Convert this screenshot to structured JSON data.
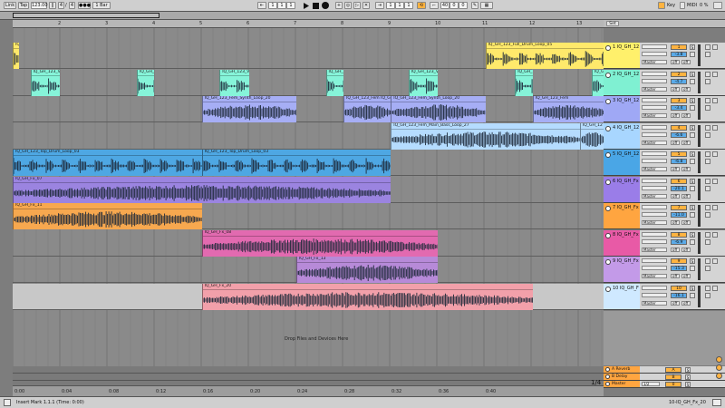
{
  "toolbar": {
    "link": "Link",
    "tap": "Tap",
    "tempo": "123.00",
    "sig_num": "4",
    "sig_den": "4",
    "metro": "●●●",
    "quant": "1 Bar",
    "pos_bar": "1",
    "pos_beat": "1",
    "pos_six": "1",
    "loop_bar": "1",
    "loop_beat": "1",
    "loop_six": "1",
    "loop_len_bar": "40",
    "loop_len_beat": "0",
    "loop_len_six": "0",
    "key": "Key",
    "midi": "MIDI",
    "cpu": "0 %"
  },
  "ruler": {
    "bars": [
      "2",
      "3",
      "4",
      "5",
      "6",
      "7",
      "8",
      "9",
      "10",
      "11",
      "12",
      "13"
    ],
    "set_label": "Set"
  },
  "timeline": {
    "marks": [
      "0:00",
      "0:04",
      "0:08",
      "0:12",
      "0:16",
      "0:20",
      "0:24",
      "0:28",
      "0:32",
      "0:36",
      "0:40"
    ]
  },
  "tracks": [
    {
      "id": 1,
      "name": "1 IQ_GH_12",
      "color": "#fff06b",
      "clip_color": "#ffe96b",
      "clips": [
        {
          "name": "IQ",
          "start": 0,
          "end": 1
        },
        {
          "name": "IQ_GH_123_Full_Drum_Loop_05",
          "start": 80,
          "end": 100
        }
      ],
      "num": "1",
      "vol": "-3.8"
    },
    {
      "id": 2,
      "name": "2 IQ_GH_12",
      "color": "#7ff0d2",
      "clip_color": "#86f4d9",
      "clips": [
        {
          "name": "IQ_GH_123_Voc",
          "start": 3,
          "end": 8
        },
        {
          "name": "IQ_GH_1",
          "start": 21,
          "end": 24
        },
        {
          "name": "IQ_GH_123_Voc",
          "start": 35,
          "end": 40
        },
        {
          "name": "IQ_GH_1",
          "start": 53,
          "end": 56
        },
        {
          "name": "IQ_GH_123_Voc",
          "start": 67,
          "end": 72
        },
        {
          "name": "IQ_GH_1",
          "start": 85,
          "end": 88
        },
        {
          "name": "IQ_GH_1",
          "start": 98,
          "end": 100
        }
      ],
      "num": "2",
      "vol": "-4.7"
    },
    {
      "id": 3,
      "name": "3 IQ_GH_12",
      "color": "#9fa8f5",
      "clip_color": "#a6aef5",
      "clips": [
        {
          "name": "IQ_GH_123_Fem_Synth_Loop_20",
          "start": 32,
          "end": 48
        },
        {
          "name": "IQ_GH_123_Fem IQ_GH_1",
          "start": 56,
          "end": 64
        },
        {
          "name": "IQ_GH_123_Fem_Synth_Loop_20",
          "start": 64,
          "end": 80
        },
        {
          "name": "IQ_GH_123_Fem",
          "start": 88,
          "end": 100
        }
      ],
      "num": "3",
      "vol": "-3.4"
    },
    {
      "id": 4,
      "name": "4 IQ_GH_12",
      "color": "#a8d6ff",
      "clip_color": "#b5dcff",
      "clips": [
        {
          "name": "IQ_GH_123_Fem_Main_Bass_Loop_27",
          "start": 64,
          "end": 96
        },
        {
          "name": "IQ_GH_12",
          "start": 96,
          "end": 100
        }
      ],
      "num": "4",
      "vol": "-6.6"
    },
    {
      "id": 5,
      "name": "5 IQ_GH_12",
      "color": "#4aa6e6",
      "clip_color": "#4ea7e3",
      "clips": [
        {
          "name": "IQ_GH_123_Top_Drum_Loop_03",
          "start": 0,
          "end": 32
        },
        {
          "name": "IQ_GH_123_Top_Drum_Loop_03",
          "start": 32,
          "end": 64
        }
      ],
      "num": "5",
      "vol": "-6.8"
    },
    {
      "id": 6,
      "name": "6 IQ_GH_Fx",
      "color": "#9a7de8",
      "clip_color": "#9b84e0",
      "clips": [
        {
          "name": "IQ_GH_Fx_07",
          "start": 0,
          "end": 64
        }
      ],
      "num": "6",
      "vol": "-20.1"
    },
    {
      "id": 7,
      "name": "7 IQ_GH_Fx",
      "color": "#ffa540",
      "clip_color": "#f7a84f",
      "clips": [
        {
          "name": "IQ_GH_Fx_11",
          "start": 0,
          "end": 32
        }
      ],
      "num": "7",
      "vol": "-11.0"
    },
    {
      "id": 8,
      "name": "8 IQ_GH_Fx",
      "color": "#e85aa6",
      "clip_color": "#e26ab0",
      "clips": [
        {
          "name": "IQ_GH_Fx_08",
          "start": 32,
          "end": 72
        }
      ],
      "num": "8",
      "vol": "-6.9"
    },
    {
      "id": 9,
      "name": "9 IQ_GH_Fx",
      "color": "#c39ae8",
      "clip_color": "#b78ad8",
      "clips": [
        {
          "name": "IQ_GH_Fx_13",
          "start": 48,
          "end": 72
        }
      ],
      "num": "9",
      "vol": "-15.3"
    },
    {
      "id": 10,
      "name": "10 IQ_GH_F",
      "color": "#cfe9ff",
      "clip_color": "#f2a0aa",
      "clips": [
        {
          "name": "IQ_GH_Fx_20",
          "start": 32,
          "end": 88
        }
      ],
      "num": "10",
      "vol": "-16.1"
    }
  ],
  "mixer_labels": {
    "master": "Master",
    "s_label": "S",
    "off": "off",
    "one_two": "1/2"
  },
  "returns": [
    {
      "name": "A Reverb",
      "color": "#ffa540",
      "num": "A"
    },
    {
      "name": "B Delay",
      "color": "#ffa540",
      "num": "B"
    },
    {
      "name": "Master",
      "color": "#ffa540",
      "num": "0"
    }
  ],
  "drop_text": "Drop Files and Devices Here",
  "status": {
    "left": "Insert Mark 1.1.1 (Time: 0:00)",
    "right": "10-IQ_GH_Fx_20"
  },
  "scale": "1/4"
}
